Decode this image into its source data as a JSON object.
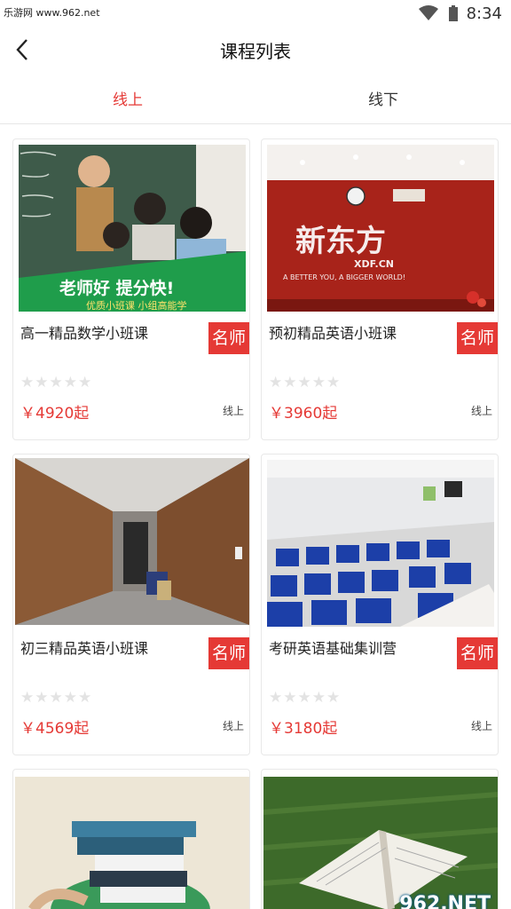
{
  "status_bar": {
    "watermark": "乐游网 www.962.net",
    "time": "8:34"
  },
  "header": {
    "title": "课程列表"
  },
  "tabs": [
    {
      "label": "线上"
    },
    {
      "label": "线下"
    }
  ],
  "colors": {
    "accent": "#e53935",
    "divider": "#e6e6e6"
  },
  "courses": [
    {
      "name": "高一精品数学小班课",
      "badge": "名师",
      "stars": "★★★★★",
      "price": "￥4920起",
      "mode": "线上",
      "banner_title": "老师好 提分快!",
      "banner_sub": "优质小班课 小组高能学"
    },
    {
      "name": "预初精品英语小班课",
      "badge": "名师",
      "stars": "★★★★★",
      "price": "￥3960起",
      "mode": "线上",
      "logo": "新东方",
      "logo_sub": "XDF.CN",
      "slogan": "A BETTER YOU, A BIGGER WORLD!"
    },
    {
      "name": "初三精品英语小班课",
      "badge": "名师",
      "stars": "★★★★★",
      "price": "￥4569起",
      "mode": "线上"
    },
    {
      "name": "考研英语基础集训营",
      "badge": "名师",
      "stars": "★★★★★",
      "price": "￥3180起",
      "mode": "线上"
    }
  ],
  "site_mark": {
    "main": "962.NET",
    "sub": "乐游网"
  }
}
